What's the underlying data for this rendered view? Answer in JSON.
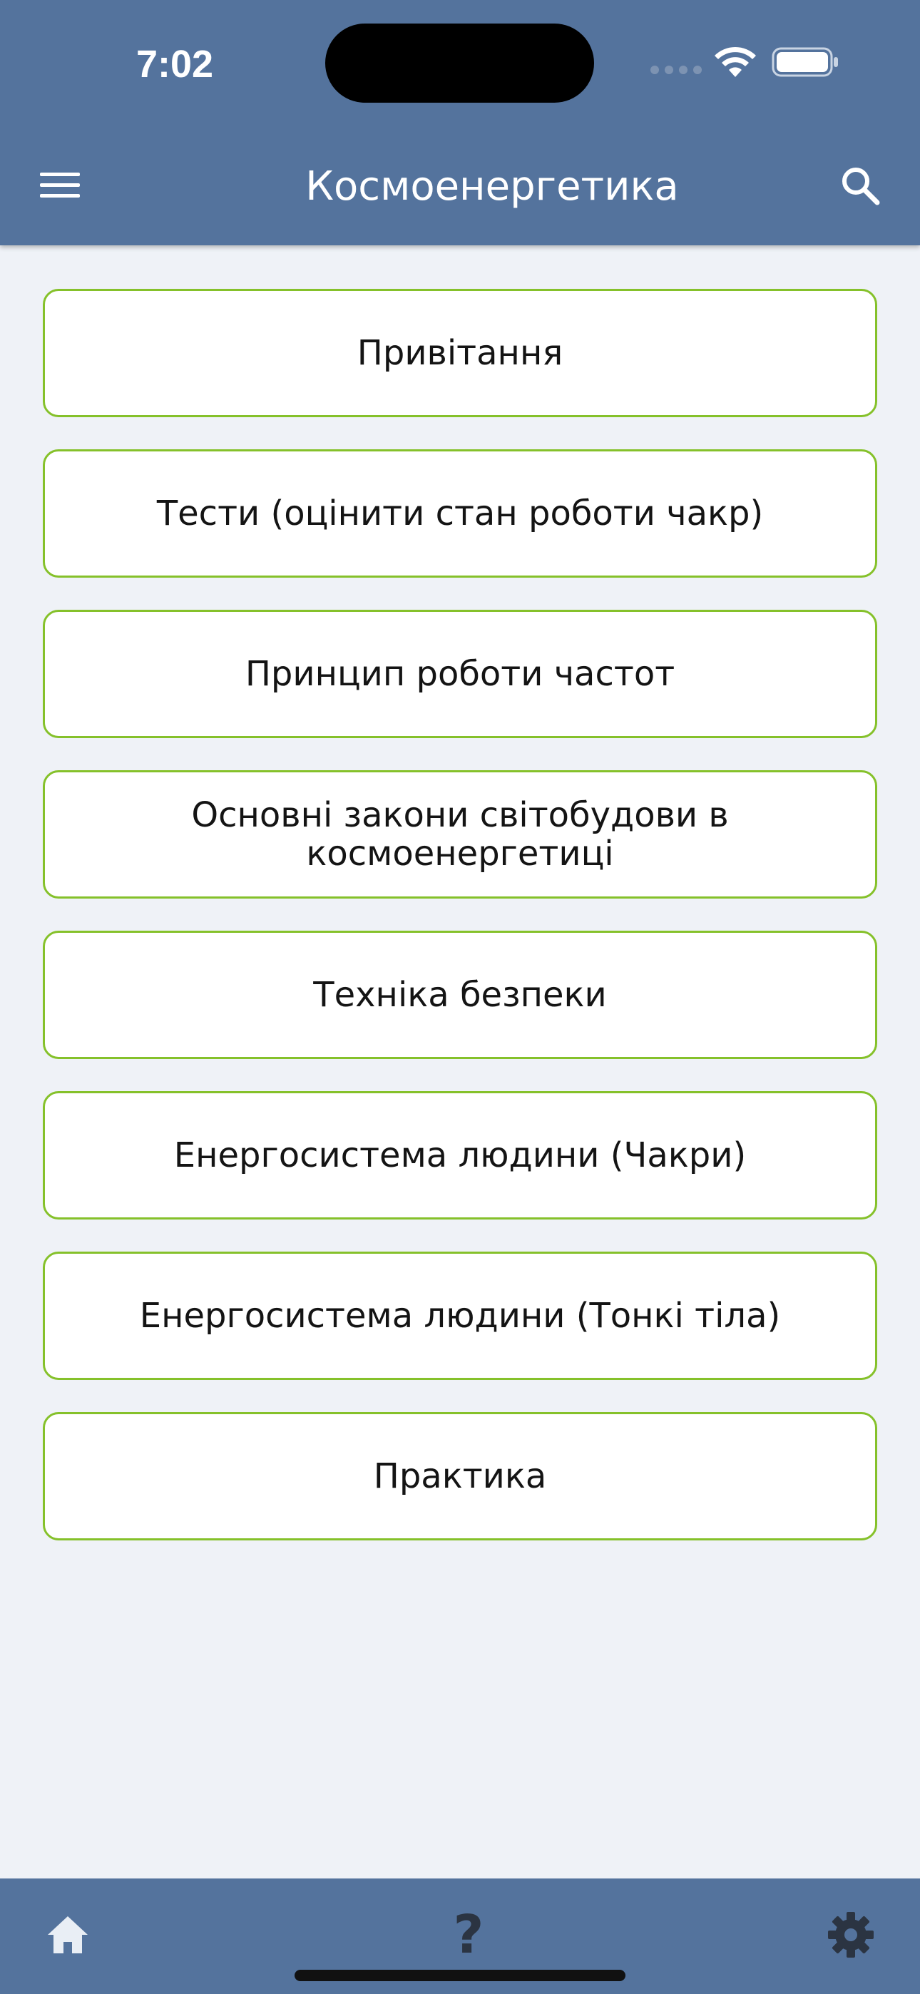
{
  "status_bar": {
    "time": "7:02"
  },
  "app_bar": {
    "title": "Космоенергетика",
    "menu_icon": "hamburger-menu-icon",
    "search_icon": "search-icon"
  },
  "menu": {
    "items": [
      {
        "label": "Привітання"
      },
      {
        "label": "Тести (оцінити стан роботи чакр)"
      },
      {
        "label": "Принцип роботи частот"
      },
      {
        "label": "Основні закони світобудови в космоенергетиці"
      },
      {
        "label": "Техніка безпеки"
      },
      {
        "label": "Енергосистема людини (Чакри)"
      },
      {
        "label": "Енергосистема людини (Тонкі тіла)"
      },
      {
        "label": "Практика"
      }
    ]
  },
  "tab_bar": {
    "home_icon": "home-icon",
    "help_glyph": "?",
    "settings_icon": "gear-icon"
  },
  "colors": {
    "bar_background": "#54739d",
    "page_background": "#eff2f7",
    "card_border": "#85c12a",
    "card_text": "#141414"
  }
}
